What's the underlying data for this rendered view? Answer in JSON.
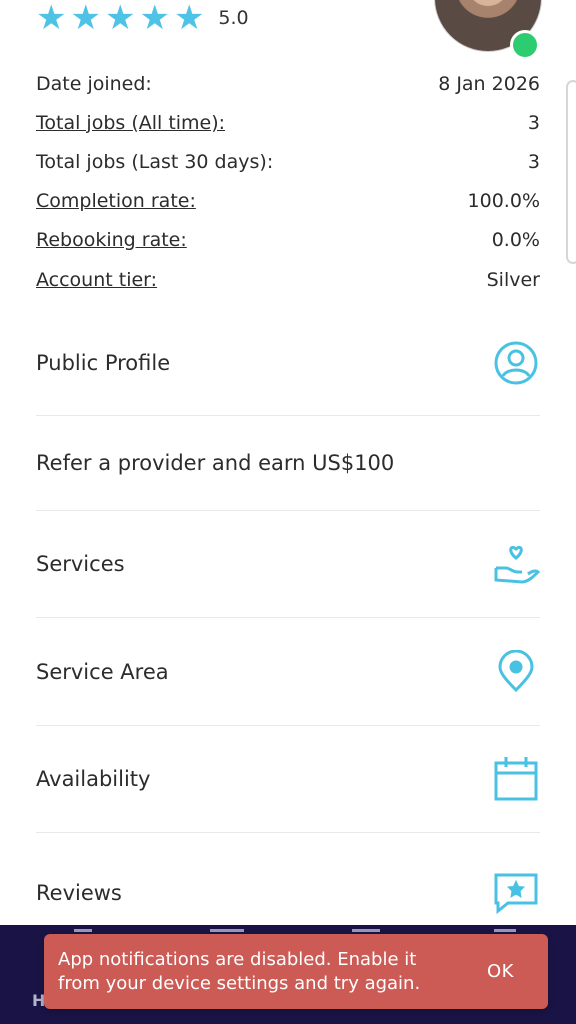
{
  "rating": {
    "value": 5.0,
    "display": "5.0",
    "max_stars": 5
  },
  "profile": {
    "status": "online",
    "status_color": "#2ecc71"
  },
  "stats": [
    {
      "label": "Date joined:",
      "value": "8 Jan 2026",
      "underlined": false
    },
    {
      "label": "Total jobs (All time):",
      "value": "3",
      "underlined": true
    },
    {
      "label": "Total jobs (Last 30 days):",
      "value": "3",
      "underlined": false
    },
    {
      "label": "Completion rate:",
      "value": "100.0%",
      "underlined": true
    },
    {
      "label": "Rebooking rate:",
      "value": "0.0%",
      "underlined": true
    },
    {
      "label": "Account tier:",
      "value": "Silver",
      "underlined": true
    }
  ],
  "menu": [
    {
      "label": "Public Profile",
      "icon": "user-circle-icon"
    },
    {
      "label": "Refer a provider and earn US$100",
      "icon": ""
    },
    {
      "label": "Services",
      "icon": "hand-heart-icon"
    },
    {
      "label": "Service Area",
      "icon": "location-pin-icon"
    },
    {
      "label": "Availability",
      "icon": "calendar-icon"
    },
    {
      "label": "Reviews",
      "icon": "star-message-icon"
    }
  ],
  "bottom_nav": {
    "partial_label": "H"
  },
  "snackbar": {
    "message": "App notifications are disabled. Enable it from your device settings and try again.",
    "action": "OK"
  },
  "colors": {
    "accent": "#49c1e3",
    "star": "#4fc3e6",
    "nav_bg": "#1a1446",
    "snackbar_bg": "#cc5b56"
  }
}
